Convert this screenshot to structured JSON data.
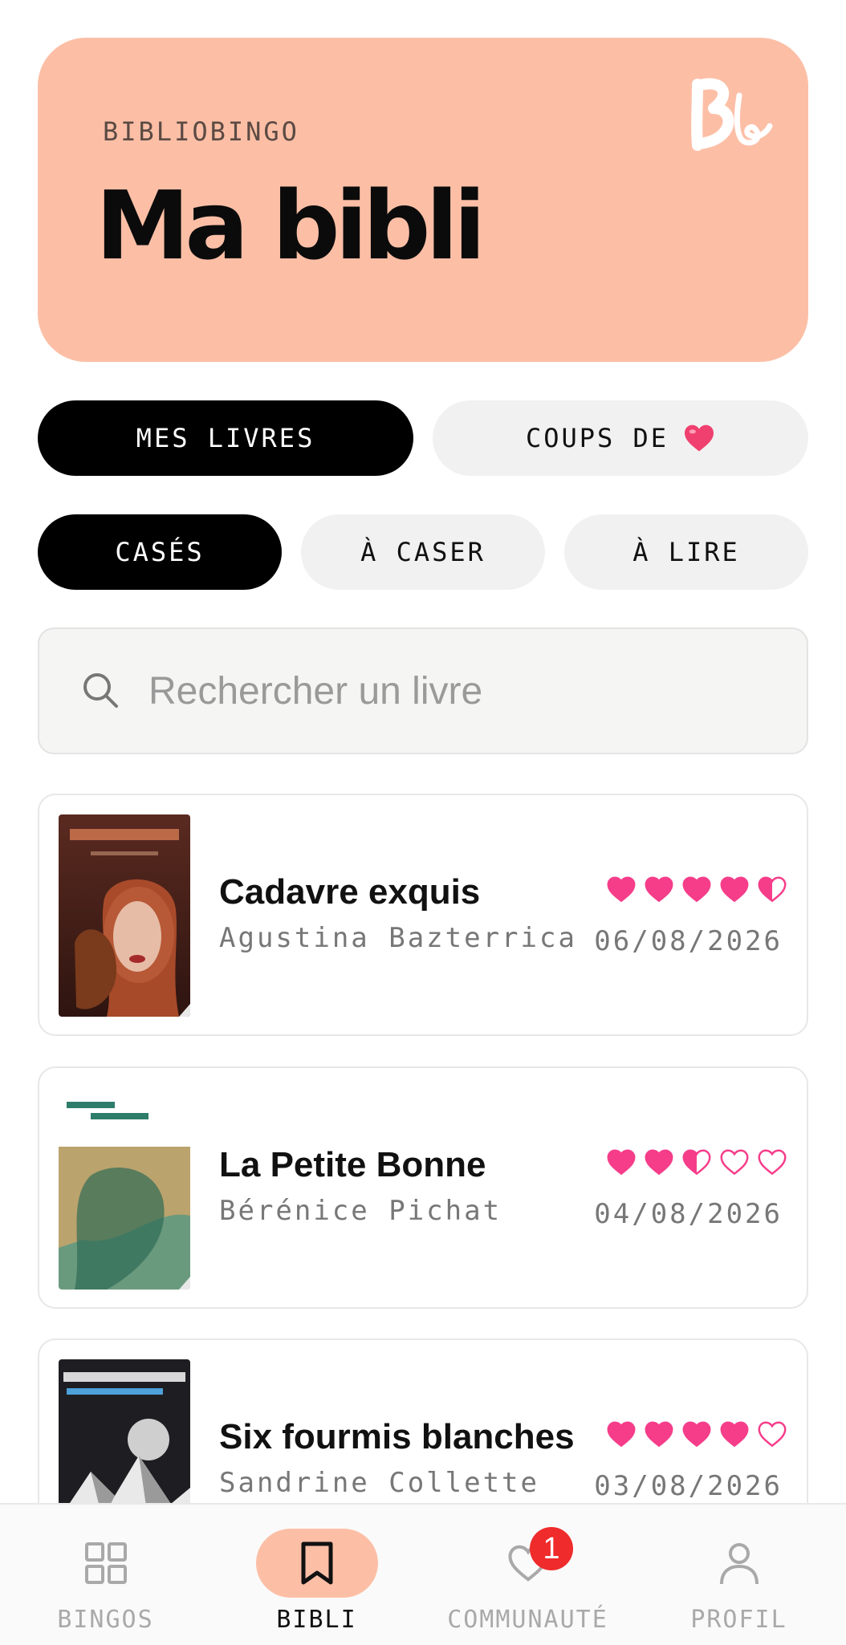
{
  "header": {
    "kicker": "BIBLIOBINGO",
    "title": "Ma bibli",
    "brand_color": "#fcbfa6"
  },
  "collection_tabs": [
    {
      "label": "MES LIVRES",
      "active": true
    },
    {
      "label": "COUPS DE",
      "icon": "heart-emoji-icon",
      "active": false
    }
  ],
  "status_tabs": [
    {
      "label": "CASÉS",
      "active": true
    },
    {
      "label": "À CASER",
      "active": false
    },
    {
      "label": "À LIRE",
      "active": false
    }
  ],
  "search": {
    "placeholder": "Rechercher un livre",
    "value": ""
  },
  "books": [
    {
      "title": "Cadavre exquis",
      "author": "Agustina Bazterrica",
      "date": "06/08/2026",
      "rating": 4.5,
      "max_rating": 5
    },
    {
      "title": "La Petite Bonne",
      "author": "Bérénice Pichat",
      "date": "04/08/2026",
      "rating": 2.5,
      "max_rating": 5
    },
    {
      "title": "Six fourmis blanches",
      "author": "Sandrine Collette",
      "date": "03/08/2026",
      "rating": 4,
      "max_rating": 5
    }
  ],
  "nav": {
    "items": [
      {
        "label": "BINGOS",
        "icon": "grid-icon",
        "active": false
      },
      {
        "label": "BIBLI",
        "icon": "bookmark-icon",
        "active": true
      },
      {
        "label": "COMMUNAUTÉ",
        "icon": "heart-outline-icon",
        "active": false,
        "badge": "1"
      },
      {
        "label": "PROFIL",
        "icon": "user-icon",
        "active": false
      }
    ]
  },
  "colors": {
    "accent": "#fcbfa6",
    "heart": "#f53d8a",
    "badge": "#ef2b2b"
  }
}
